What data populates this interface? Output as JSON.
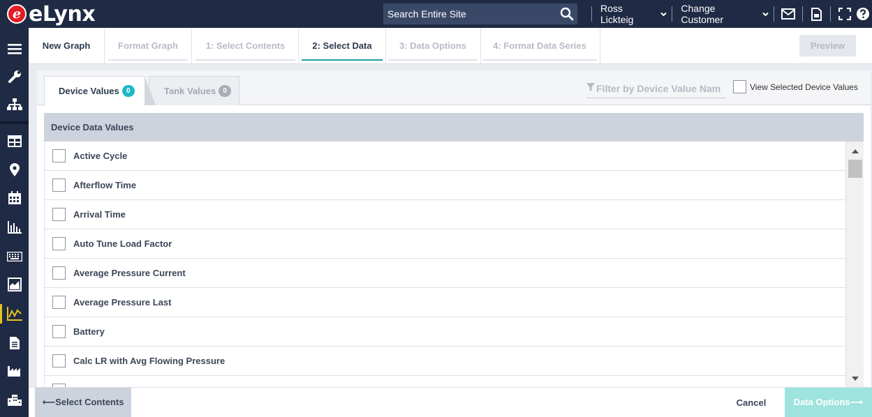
{
  "app": {
    "logo_mark": "e",
    "logo_text": "eLynx"
  },
  "header": {
    "search": {
      "placeholder": "Search Entire Site"
    },
    "user_name": "Ross Lickteig",
    "change_customer": "Change Customer"
  },
  "wizard": {
    "tabs": [
      {
        "label": "New Graph"
      },
      {
        "label": "Format Graph"
      },
      {
        "label": "1: Select Contents"
      },
      {
        "label": "2: Select Data"
      },
      {
        "label": "3: Data Options"
      },
      {
        "label": "4: Format Data Series"
      }
    ],
    "preview_label": "Preview"
  },
  "subtabs": {
    "device": {
      "label": "Device Values",
      "count": "0"
    },
    "tank": {
      "label": "Tank Values",
      "count": "0"
    }
  },
  "filter": {
    "placeholder": "Filter by Device Value Name"
  },
  "view_selected_label": "View Selected Device Values",
  "list": {
    "header": "Device Data Values",
    "items": [
      "Active Cycle",
      "Afterflow Time",
      "Arrival Time",
      "Auto Tune Load Factor",
      "Average Pressure Current",
      "Average Pressure Last",
      "Battery",
      "Calc LR with Avg Flowing Pressure",
      ""
    ]
  },
  "footer": {
    "back_label": "⟵Select Contents",
    "cancel_label": "Cancel",
    "next_label": "Data Options⟶"
  }
}
